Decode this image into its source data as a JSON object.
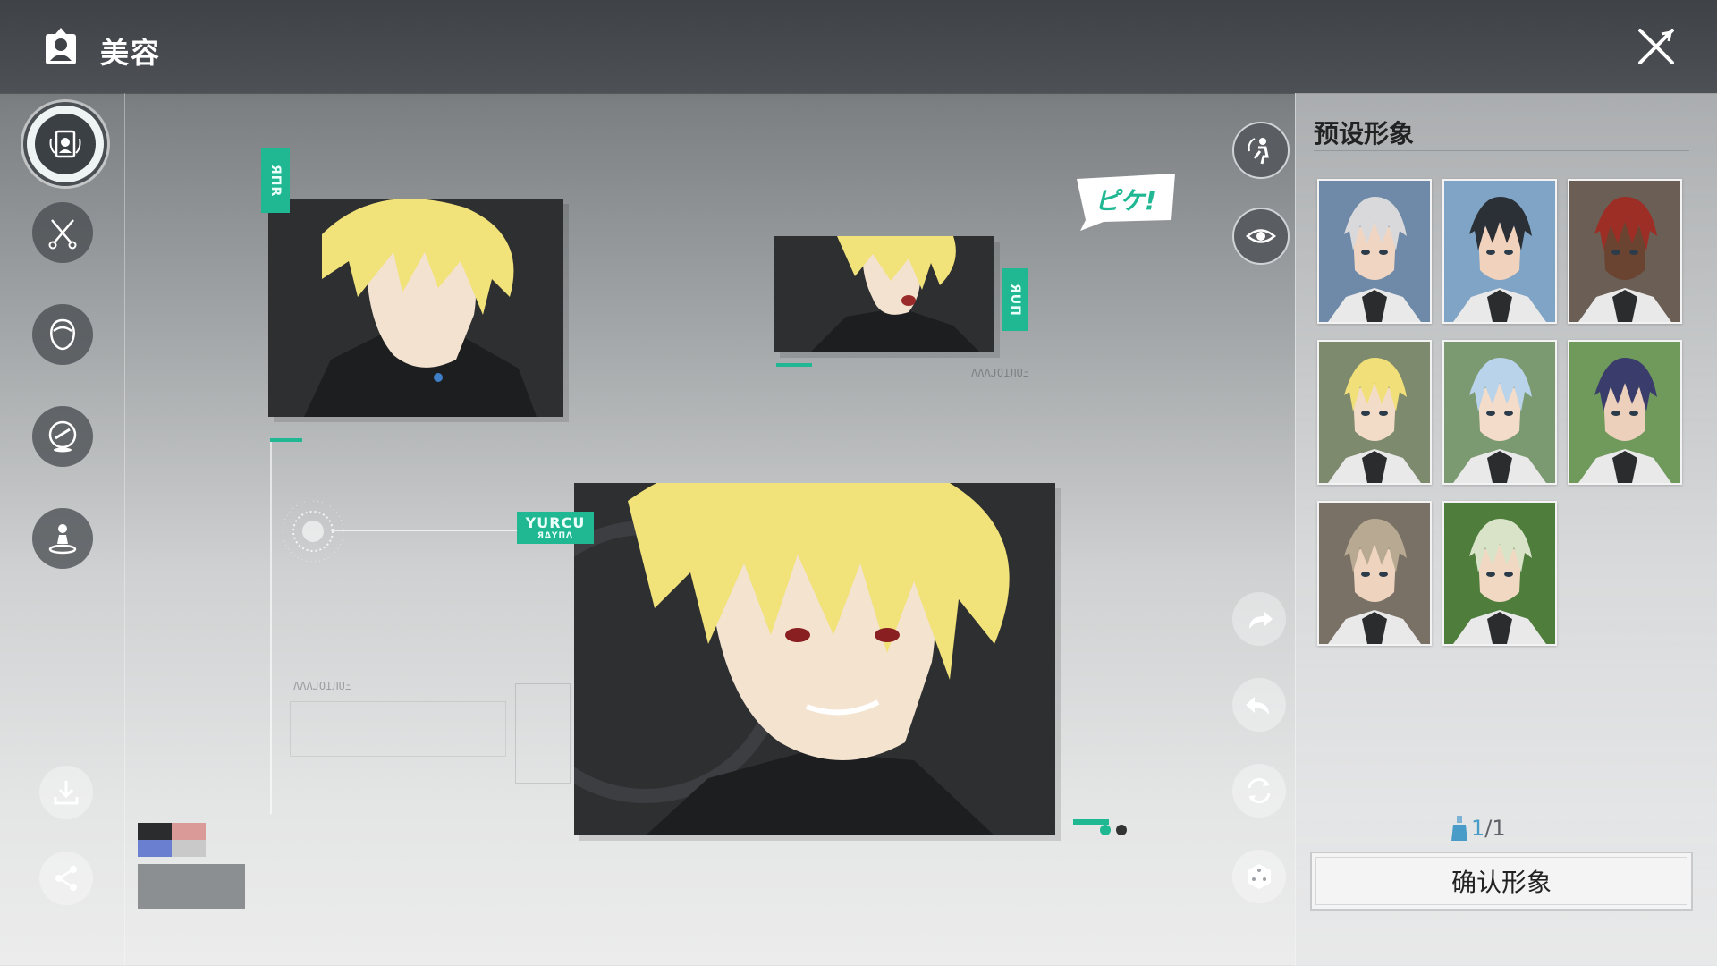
{
  "header": {
    "title": "美容",
    "title_icon": "portrait-frame-icon",
    "close_icon": "close-x-icon"
  },
  "left_rail": {
    "items": [
      {
        "name": "preset-appearance",
        "icon": "face-card-icon",
        "active": true
      },
      {
        "name": "hairstyle",
        "icon": "scissors-comb-icon",
        "active": false
      },
      {
        "name": "face",
        "icon": "face-icon",
        "active": false
      },
      {
        "name": "makeup",
        "icon": "makeup-icon",
        "active": false
      },
      {
        "name": "pose",
        "icon": "figure-pedestal-icon",
        "active": false
      }
    ],
    "utilities": [
      {
        "name": "download",
        "icon": "download-icon"
      },
      {
        "name": "share",
        "icon": "share-icon"
      }
    ]
  },
  "stage": {
    "tags": {
      "top_left": "ЯΠR",
      "top_right": "ЯUΠ",
      "center": "YURCU",
      "center_sub": "ЯΔYΠΛ"
    },
    "speech_bubble": "ピケ!",
    "deco_label": "ΛΛΛJOIЛUΞ"
  },
  "right_tools": [
    {
      "name": "pose-toggle",
      "icon": "character-motion-icon",
      "style": "dark"
    },
    {
      "name": "visibility-toggle",
      "icon": "eye-icon",
      "style": "dark"
    },
    {
      "name": "redo",
      "icon": "redo-icon",
      "style": "light"
    },
    {
      "name": "undo",
      "icon": "undo-icon",
      "style": "light"
    },
    {
      "name": "reset",
      "icon": "refresh-icon",
      "style": "light"
    },
    {
      "name": "randomize",
      "icon": "dice-icon",
      "style": "light"
    }
  ],
  "presets": {
    "title": "预设形象",
    "items": [
      {
        "hair": "#d9d9dc",
        "skin": "#f0d6c2",
        "bg": "#6e8aa8"
      },
      {
        "hair": "#2b2f36",
        "skin": "#f1d3bd",
        "bg": "#7fa4c6"
      },
      {
        "hair": "#9c2e26",
        "skin": "#6b4331",
        "bg": "#6a5e55"
      },
      {
        "hair": "#f1df7a",
        "skin": "#f3dcc7",
        "bg": "#7d8a6d"
      },
      {
        "hair": "#b9d3ea",
        "skin": "#f3dcc9",
        "bg": "#7c9a72"
      },
      {
        "hair": "#3a3d6b",
        "skin": "#ecd0bc",
        "bg": "#6f9a5c"
      },
      {
        "hair": "#b8aa92",
        "skin": "#eed4bf",
        "bg": "#7a7166"
      },
      {
        "hair": "#d8e3c8",
        "skin": "#f0d8c3",
        "bg": "#4f7d3c"
      }
    ],
    "count_current": "1",
    "count_total": "/1",
    "count_icon": "potion-icon",
    "confirm_label": "确认形象"
  },
  "colors": {
    "accent": "#1fb893",
    "hair": "#f2e27a",
    "panel_dark": "#2f3133"
  }
}
